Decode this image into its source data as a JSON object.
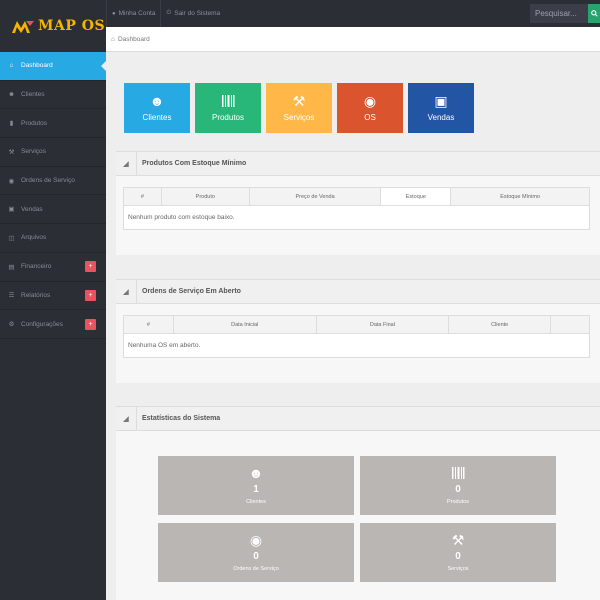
{
  "header": {
    "logo_text": "MAP OS",
    "links": [
      {
        "icon": "user-icon",
        "label": "Minha Conta"
      },
      {
        "icon": "power-icon",
        "label": "Sair do Sistema"
      }
    ],
    "search_placeholder": "Pesquisar..."
  },
  "sidebar": {
    "items": [
      {
        "label": "Dashboard",
        "icon": "home-icon",
        "active": true
      },
      {
        "label": "Clientes",
        "icon": "users-icon"
      },
      {
        "label": "Produtos",
        "icon": "barcode-icon"
      },
      {
        "label": "Serviços",
        "icon": "wrench-icon"
      },
      {
        "label": "Ordens de Serviço",
        "icon": "tags-icon"
      },
      {
        "label": "Vendas",
        "icon": "cart-icon"
      },
      {
        "label": "Arquivos",
        "icon": "hdd-icon"
      },
      {
        "label": "Financeiro",
        "icon": "money-icon",
        "badge": "+"
      },
      {
        "label": "Relatórios",
        "icon": "list-icon",
        "badge": "+"
      },
      {
        "label": "Configurações",
        "icon": "cog-icon",
        "badge": "+"
      }
    ]
  },
  "breadcrumb": {
    "label": "Dashboard"
  },
  "quick_buttons": [
    {
      "label": "Clientes",
      "icon": "users-icon",
      "color": "#27a9e3"
    },
    {
      "label": "Produtos",
      "icon": "barcode-icon",
      "color": "#28b779"
    },
    {
      "label": "Serviços",
      "icon": "wrench-icon",
      "color": "#ffb848"
    },
    {
      "label": "OS",
      "icon": "tags-icon",
      "color": "#da542e"
    },
    {
      "label": "Vendas",
      "icon": "cart-icon",
      "color": "#2255a4"
    }
  ],
  "stock_widget": {
    "title": "Produtos Com Estoque Mínimo",
    "columns": [
      "#",
      "Produto",
      "Preço de Venda",
      "Estoque",
      "Estoque Mínimo"
    ],
    "empty_text": "Nenhum produto com estoque baixo."
  },
  "os_widget": {
    "title": "Ordens de Serviço Em Aberto",
    "columns": [
      "#",
      "Data Inicial",
      "Data Final",
      "Cliente"
    ],
    "empty_text": "Nenhuma OS em aberto."
  },
  "stats_widget": {
    "title": "Estatísticas do Sistema",
    "tiles": [
      {
        "value": "1",
        "label": "Clientes",
        "icon": "users-icon"
      },
      {
        "value": "0",
        "label": "Produtos",
        "icon": "barcode-icon"
      },
      {
        "value": "0",
        "label": "Ordens de Serviço",
        "icon": "tags-icon"
      },
      {
        "value": "0",
        "label": "Serviços",
        "icon": "wrench-icon"
      }
    ]
  },
  "colors": {
    "sidebar_bg": "#2c2e36",
    "accent": "#27a9e3",
    "stat_tile": "#b9b6b3",
    "badge": "#e9535f"
  }
}
